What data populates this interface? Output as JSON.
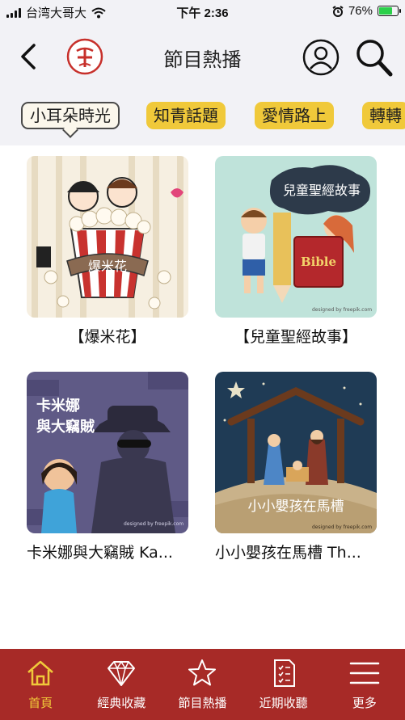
{
  "status_bar": {
    "carrier": "台湾大哥大",
    "time": "下午 2:36",
    "battery": "76%",
    "battery_level": 0.76
  },
  "header": {
    "title": "節目熱播"
  },
  "tabs": [
    {
      "label": "小耳朵時光",
      "active": true
    },
    {
      "label": "知青話題",
      "active": false
    },
    {
      "label": "愛情路上",
      "active": false
    },
    {
      "label": "轉轉",
      "active": false
    }
  ],
  "programs": [
    {
      "title": "【爆米花】",
      "art_text": "爆米花"
    },
    {
      "title": "【兒童聖經故事】",
      "art_text": "兒童聖經故事",
      "bible_text": "Bible",
      "credit": "designed by freepik.com"
    },
    {
      "title": "卡米娜與大竊賊 Ka...",
      "art_text_1": "卡米娜",
      "art_text_2": "與大竊賊",
      "credit": "designed by freepik.com"
    },
    {
      "title": "小小嬰孩在馬槽 Th...",
      "art_text": "小小嬰孩在馬槽",
      "credit": "designed by freepik.com"
    }
  ],
  "bottom_nav": [
    {
      "label": "首頁",
      "icon": "home-icon",
      "active": true
    },
    {
      "label": "經典收藏",
      "icon": "diamond-icon",
      "active": false
    },
    {
      "label": "節目熱播",
      "icon": "star-icon",
      "active": false
    },
    {
      "label": "近期收聽",
      "icon": "list-icon",
      "active": false
    },
    {
      "label": "更多",
      "icon": "menu-icon",
      "active": false
    }
  ],
  "colors": {
    "accent": "#f0c93a",
    "nav_bg": "#a72a27",
    "header_bg": "#f2f2f6"
  }
}
